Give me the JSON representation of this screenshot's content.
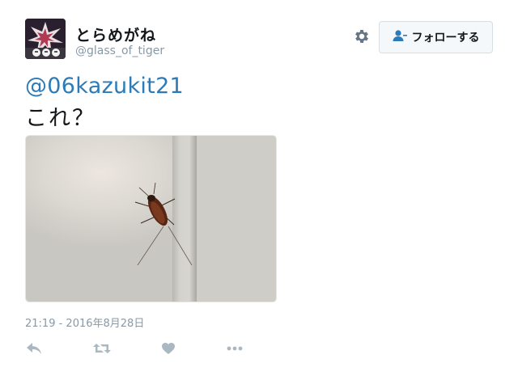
{
  "user": {
    "display_name": "とらめがね",
    "handle": "@glass_of_tiger"
  },
  "follow_button": {
    "label": "フォローする",
    "icon": "person-plus-icon"
  },
  "settings": {
    "icon": "gear-icon"
  },
  "tweet": {
    "mention": "@06kazukit21",
    "text": "これ？",
    "media": "photo of a cockroach on a white wall",
    "timestamp": "21:19 - 2016年8月28日"
  },
  "actions": [
    {
      "name": "reply",
      "icon": "reply-icon"
    },
    {
      "name": "retweet",
      "icon": "retweet-icon"
    },
    {
      "name": "like",
      "icon": "heart-icon"
    },
    {
      "name": "more",
      "icon": "more-icon"
    }
  ],
  "colors": {
    "link": "#2b7bb9",
    "meta_gray": "#8899a6",
    "icon_gray": "#aab8c2",
    "button_bg": "#f5f8fa"
  }
}
